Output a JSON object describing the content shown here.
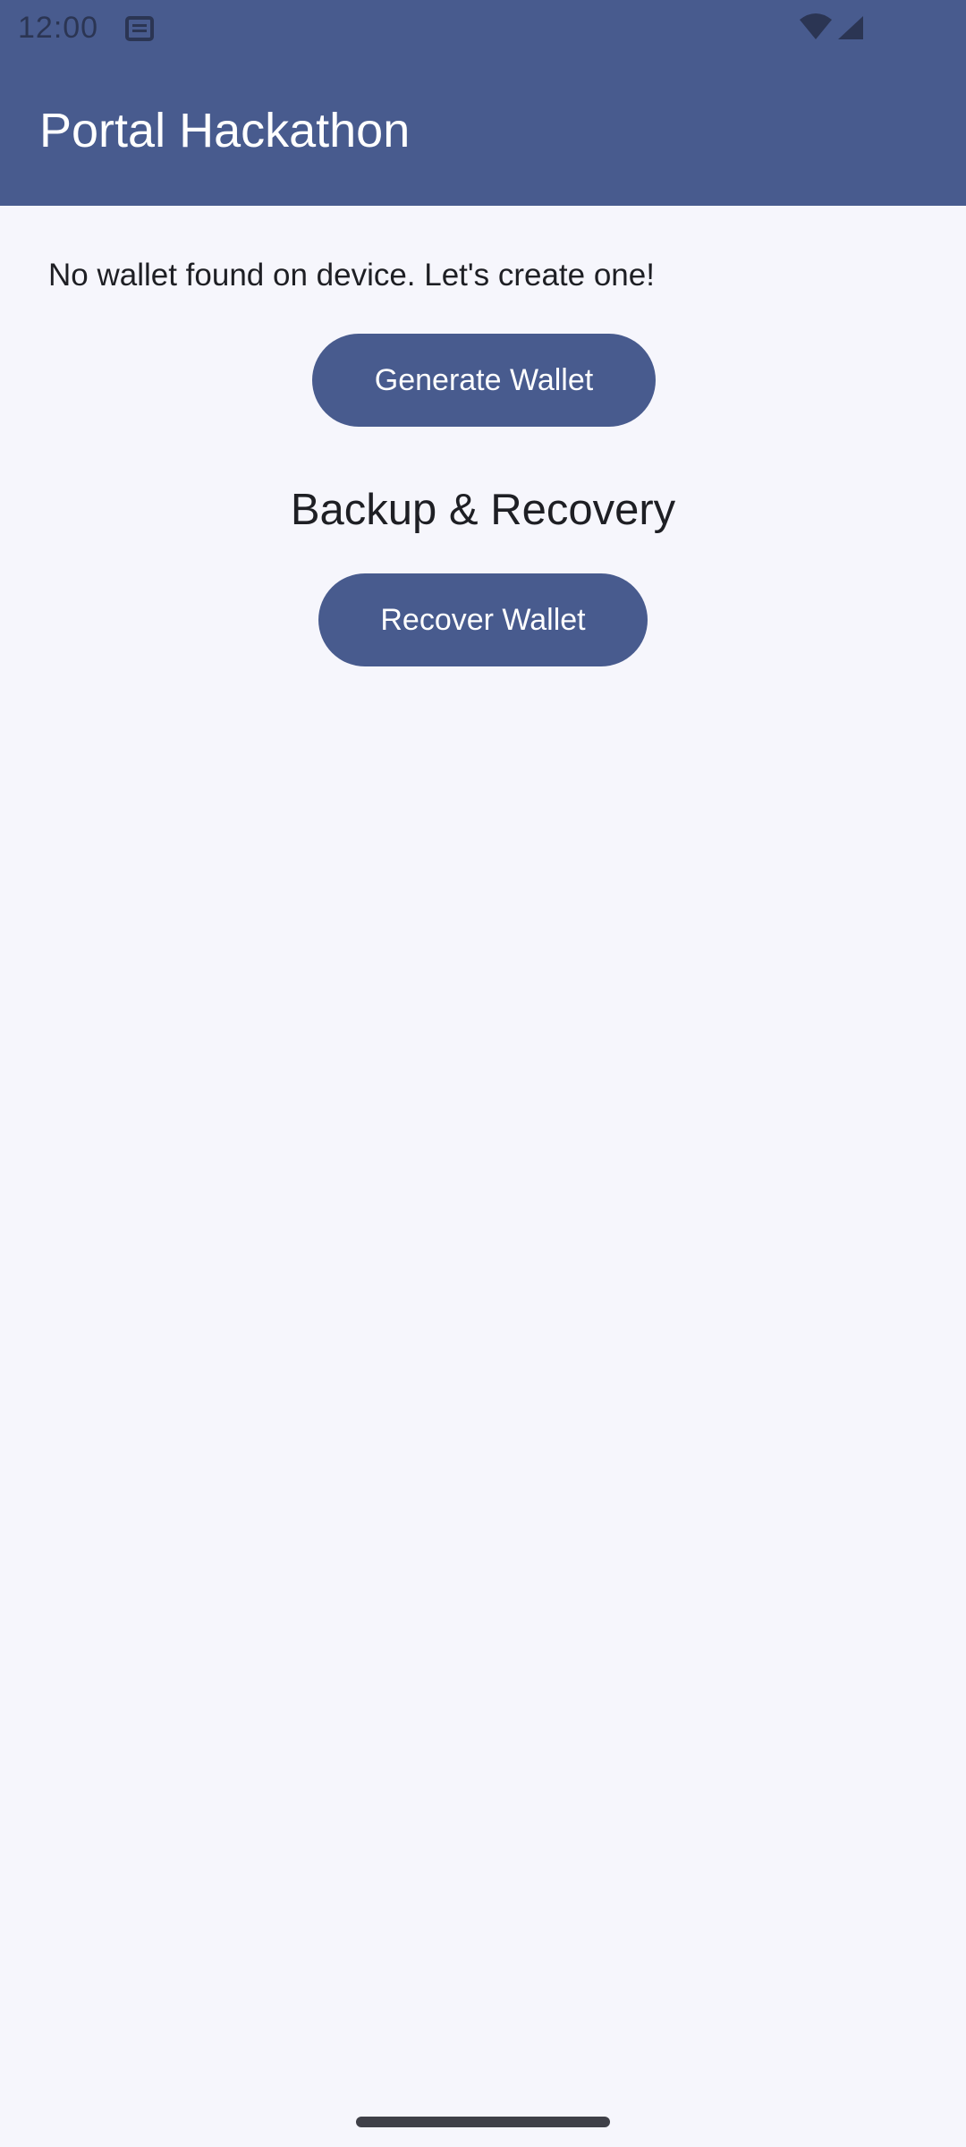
{
  "status_bar": {
    "time": "12:00",
    "icons": [
      "notification-icon",
      "wifi-icon",
      "signal-icon"
    ]
  },
  "app_bar": {
    "title": "Portal Hackathon"
  },
  "main": {
    "info_text": "No wallet found on device. Let's create one!",
    "generate_button_label": "Generate Wallet",
    "backup_heading": "Backup & Recovery",
    "recover_button_label": "Recover Wallet"
  },
  "colors": {
    "primary": "#485b8e",
    "background": "#f6f6fc",
    "on_primary": "#ffffff",
    "text": "#1e1f24"
  }
}
